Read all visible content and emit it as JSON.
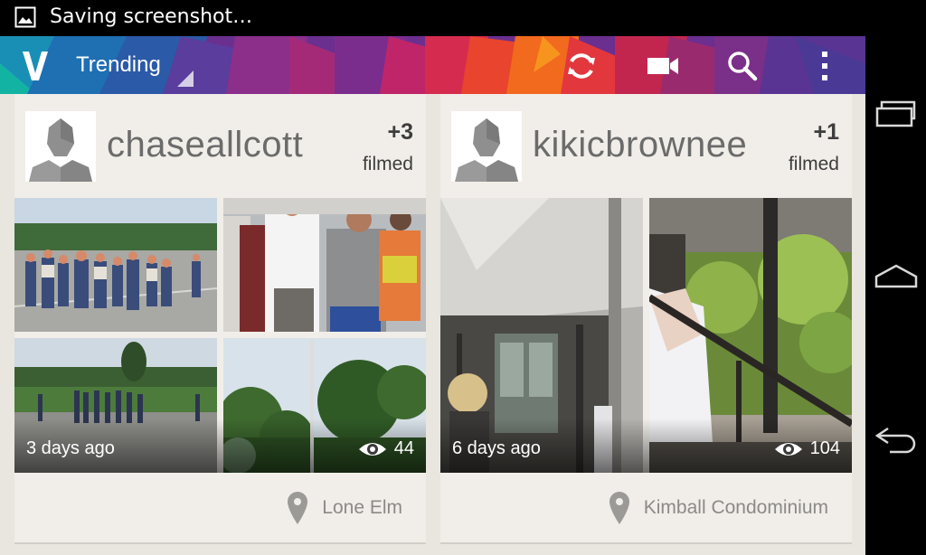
{
  "status_bar": {
    "notification_icon": "image-icon",
    "text": "Saving screenshot…"
  },
  "action_bar": {
    "title": "Trending",
    "logo_icon": "vine-logo-icon",
    "actions": [
      {
        "name": "refresh",
        "icon": "refresh-icon"
      },
      {
        "name": "record",
        "icon": "video-camera-icon"
      },
      {
        "name": "search",
        "icon": "search-icon"
      },
      {
        "name": "overflow",
        "icon": "overflow-menu-icon"
      }
    ]
  },
  "cards": [
    {
      "username": "chaseallcott",
      "count": "+3",
      "count_label": "filmed",
      "time": "3 days ago",
      "views": "44",
      "location": "Lone Elm"
    },
    {
      "username": "kikicbrownee",
      "count": "+1",
      "count_label": "filmed",
      "time": "6 days ago",
      "views": "104",
      "location": "Kimball Condominium"
    }
  ],
  "nav_bar": {
    "buttons": [
      {
        "name": "recents",
        "icon": "recents-icon"
      },
      {
        "name": "home",
        "icon": "home-icon"
      },
      {
        "name": "back",
        "icon": "back-icon"
      }
    ]
  },
  "colors": {
    "content_bg": "#e9e6e0",
    "card_bg": "#f1eee9",
    "username_text": "#6b6b6b",
    "location_text": "#8c8a87"
  }
}
